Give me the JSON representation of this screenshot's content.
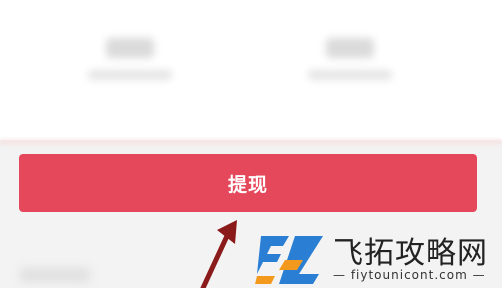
{
  "withdraw_button": {
    "label": "提现",
    "color": "#e5485b"
  },
  "watermark": {
    "brand_text": "飞拓攻略网",
    "url_text": "— fiytounicont.com —"
  },
  "colors": {
    "arrow": "#8b1a1a",
    "logo_blue": "#2a7fd4",
    "logo_orange": "#f39a1e"
  }
}
